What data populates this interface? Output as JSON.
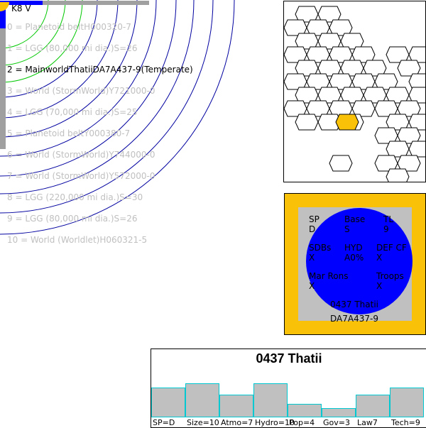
{
  "system": {
    "star_label": "K8 V",
    "orbits": [
      {
        "label": "0 = Planetoid beltH000320-7",
        "main": false
      },
      {
        "label": "1 = LGG (80,000 mi dia.)S=26",
        "main": false
      },
      {
        "label": "2 = MainworldThatiiDA7A437-9(Temperate)",
        "main": true
      },
      {
        "label": "3 = World  (StormWorld)Y721000-0",
        "main": false
      },
      {
        "label": "4 = LGG (70,000 mi dia.)S=25",
        "main": false
      },
      {
        "label": "5 = Planetoid beltY000380-7",
        "main": false
      },
      {
        "label": "6 = World  (StormWorld)Y744000-0",
        "main": false
      },
      {
        "label": "7 = World  (StormWorld)Y572000-0",
        "main": false
      },
      {
        "label": "8 = LGG (220,000 mi dia.)S=30",
        "main": false
      },
      {
        "label": "9 = LGG (80,000 mi dia.)S=26",
        "main": false
      },
      {
        "label": "10 = World  (Worldlet)H060321-5",
        "main": false
      }
    ],
    "colors": {
      "inner_orbit": "#00c800",
      "outer_orbit": "#0000a0",
      "star": "#f9c107",
      "highlight_hex": "#f9c107"
    }
  },
  "world": {
    "cells": [
      {
        "key": "sp_label",
        "text": "SP"
      },
      {
        "key": "sp_value",
        "text": "D"
      },
      {
        "key": "base_label",
        "text": "Base"
      },
      {
        "key": "base_value",
        "text": "S"
      },
      {
        "key": "tl_label",
        "text": "TL"
      },
      {
        "key": "tl_value",
        "text": "9"
      },
      {
        "key": "sdbs_label",
        "text": "SDBs"
      },
      {
        "key": "sdbs_value",
        "text": "X"
      },
      {
        "key": "hyd_label",
        "text": "HYD"
      },
      {
        "key": "hyd_value",
        "text": "A0%"
      },
      {
        "key": "defcf_label",
        "text": "DEF CF"
      },
      {
        "key": "defcf_value",
        "text": "X"
      },
      {
        "key": "marrons_label",
        "text": "Mar Rons"
      },
      {
        "key": "marrons_value",
        "text": "X"
      },
      {
        "key": "troops_label",
        "text": "Troops"
      },
      {
        "key": "troops_value",
        "text": "X"
      },
      {
        "key": "name",
        "text": "0437 Thatii"
      },
      {
        "key": "uwp",
        "text": "DA7A437-9"
      }
    ]
  },
  "profile": {
    "title": "0437 Thatii",
    "bars": [
      {
        "label": "SP=D",
        "level": 0.72
      },
      {
        "label": "Size=10",
        "level": 0.82
      },
      {
        "label": "Atmo=7",
        "level": 0.56
      },
      {
        "label": "Hydro=10",
        "level": 0.82
      },
      {
        "label": "Pop=4",
        "level": 0.32
      },
      {
        "label": "Gov=3",
        "level": 0.23
      },
      {
        "label": "Law7",
        "level": 0.56
      },
      {
        "label": "Tech=9",
        "level": 0.72
      }
    ]
  }
}
